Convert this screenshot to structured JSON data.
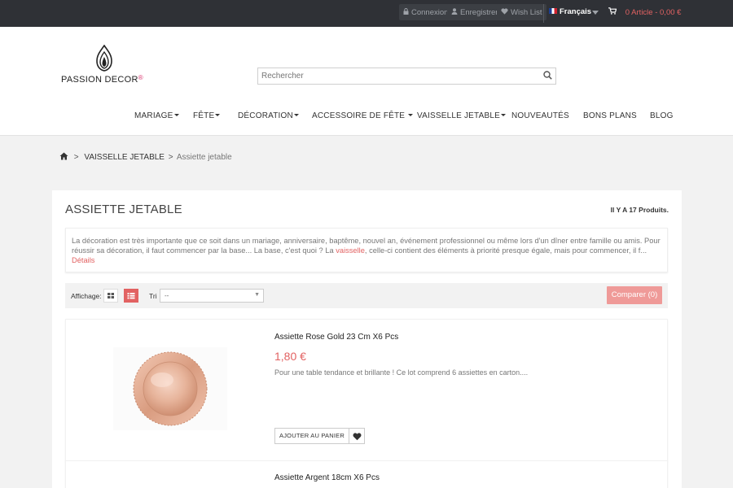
{
  "topbar": {
    "login": {
      "label": "Connexion",
      "icon": "lock-icon"
    },
    "register": {
      "label": "Enregistrer",
      "icon": "user-icon"
    },
    "wishlist": {
      "label": "Wish List",
      "icon": "heart-icon"
    },
    "language": {
      "label": "Français",
      "icon": "french-flag-icon"
    },
    "cart": {
      "label": "0 Article - 0,00 €",
      "icon": "cart-icon"
    }
  },
  "header": {
    "logo_primary": "PASSION ",
    "logo_secondary": "DECOR",
    "logo_reg": "®",
    "search_placeholder": "Rechercher"
  },
  "nav": [
    {
      "label": "MARIAGE",
      "has_caret": true
    },
    {
      "label": "FÊTE",
      "has_caret": true
    },
    {
      "label": "DÉCORATION",
      "has_caret": true
    },
    {
      "label": "ACCESSOIRE DE FÊTE",
      "has_caret": true
    },
    {
      "label": "VAISSELLE JETABLE",
      "has_caret": true
    },
    {
      "label": "NOUVEAUTÉS",
      "has_caret": false
    },
    {
      "label": "BONS PLANS",
      "has_caret": false
    },
    {
      "label": "BLOG",
      "has_caret": false
    }
  ],
  "breadcrumb": {
    "sep": ">",
    "parent": "VAISSELLE JETABLE",
    "current": "Assiette jetable"
  },
  "category": {
    "title": "ASSIETTE JETABLE",
    "count": "Il Y A 17 Produits.",
    "desc_part1": "La décoration est très importante que ce soit dans un mariage, anniversaire, baptême, nouvel an, événement professionnel ou même lors d'un dîner entre famille ou amis. Pour réussir sa décoration, il faut commencer par la base... La base, c'est quoi ? La ",
    "desc_link": "vaisselle",
    "desc_part2": ", celle-ci contient des éléments à priorité presque égale, mais pour commencer, il f...",
    "details_link": "Détails"
  },
  "toolbar": {
    "display_label": "Affichage:",
    "sort_label": "Tri",
    "sort_value": "--",
    "compare_label": "Comparer (0)"
  },
  "products": [
    {
      "name": "Assiette Rose Gold 23 Cm X6 Pcs",
      "price": "1,80 €",
      "desc": "Pour une table tendance et brillante ! Ce lot comprend 6 assiettes en carton....",
      "add_label": "AJOUTER AU PANIER"
    },
    {
      "name": "Assiette Argent 18cm X6 Pcs"
    }
  ],
  "colors": {
    "accent": "#e26262",
    "topbar": "#2f3136",
    "rose_gold": "#e7b49b"
  }
}
